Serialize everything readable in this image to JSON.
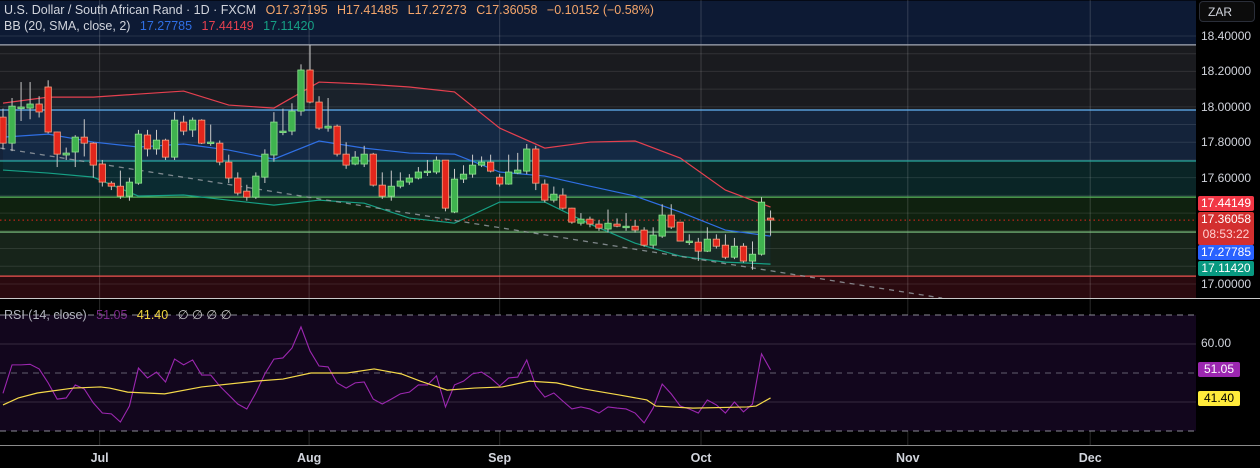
{
  "header": {
    "symbol_title": "U.S. Dollar / South African Rand · 1D · FXCM",
    "open": "O17.37195",
    "high": "H17.41485",
    "low": "L17.27273",
    "close": "C17.36058",
    "change": "−0.10152 (−0.58%)"
  },
  "bb_legend": {
    "label": "BB (20, SMA, close, 2)",
    "basis": "17.27785",
    "upper": "17.44149",
    "lower": "17.11420"
  },
  "rsi_legend": {
    "label": "RSI (14, close)",
    "rsi": "51.05",
    "ma": "41.40",
    "extras": "∅ ∅ ∅ ∅"
  },
  "price_axis": {
    "currency_button": "ZAR",
    "ticks": [
      "18.40000",
      "18.20000",
      "18.00000",
      "17.80000",
      "17.60000",
      "17.00000"
    ],
    "tick_values": [
      18.4,
      18.2,
      18.0,
      17.8,
      17.6,
      17.0
    ],
    "tags": {
      "upper": "17.44149",
      "last": "17.36058",
      "countdown": "08:53:22",
      "basis": "17.27785",
      "lower": "17.11420"
    }
  },
  "rsi_axis": {
    "tick": "60.00",
    "rsi_tag": "51.05",
    "ma_tag": "41.40"
  },
  "time_axis": [
    {
      "label": "Jul",
      "index": 10.7
    },
    {
      "label": "Aug",
      "index": 33.9
    },
    {
      "label": "Sep",
      "index": 55.0
    },
    {
      "label": "Oct",
      "index": 77.3
    },
    {
      "label": "Nov",
      "index": 100.2
    },
    {
      "label": "Dec",
      "index": 120.4
    }
  ],
  "colors": {
    "up": "#3fb34f",
    "down": "#e3261c",
    "bb_basis": "#2f6fe4",
    "bb_upper": "#e5404f",
    "bb_lower": "#16a085",
    "rsi": "#9c27b0",
    "rsi_ma": "#f5d94a",
    "ohlc_text": "#f5a66b"
  },
  "chart_data": {
    "type": "candlestick",
    "price_range": [
      16.9,
      18.45
    ],
    "candles": [
      [
        17.942,
        17.99,
        17.76,
        17.795
      ],
      [
        17.795,
        18.05,
        17.75,
        18.004
      ],
      [
        17.999,
        18.14,
        17.92,
        17.999
      ],
      [
        17.993,
        18.14,
        17.93,
        18.016
      ],
      [
        18.016,
        18.06,
        17.94,
        17.971
      ],
      [
        18.112,
        18.15,
        17.85,
        17.858
      ],
      [
        17.858,
        17.86,
        17.66,
        17.733
      ],
      [
        17.728,
        17.77,
        17.7,
        17.739
      ],
      [
        17.745,
        17.84,
        17.66,
        17.829
      ],
      [
        17.829,
        17.93,
        17.72,
        17.795
      ],
      [
        17.795,
        17.8,
        17.6,
        17.671
      ],
      [
        17.677,
        17.7,
        17.55,
        17.575
      ],
      [
        17.569,
        17.58,
        17.53,
        17.552
      ],
      [
        17.552,
        17.64,
        17.48,
        17.496
      ],
      [
        17.496,
        17.6,
        17.47,
        17.575
      ],
      [
        17.569,
        17.87,
        17.56,
        17.846
      ],
      [
        17.841,
        17.87,
        17.72,
        17.762
      ],
      [
        17.762,
        17.87,
        17.73,
        17.812
      ],
      [
        17.812,
        17.82,
        17.7,
        17.716
      ],
      [
        17.716,
        17.97,
        17.7,
        17.925
      ],
      [
        17.914,
        17.95,
        17.84,
        17.863
      ],
      [
        17.869,
        17.94,
        17.83,
        17.925
      ],
      [
        17.925,
        17.93,
        17.79,
        17.795
      ],
      [
        17.801,
        17.9,
        17.78,
        17.801
      ],
      [
        17.795,
        17.81,
        17.67,
        17.688
      ],
      [
        17.688,
        17.73,
        17.57,
        17.598
      ],
      [
        17.598,
        17.63,
        17.5,
        17.513
      ],
      [
        17.524,
        17.56,
        17.47,
        17.49
      ],
      [
        17.49,
        17.63,
        17.48,
        17.609
      ],
      [
        17.603,
        17.76,
        17.57,
        17.733
      ],
      [
        17.728,
        17.97,
        17.69,
        17.914
      ],
      [
        17.858,
        17.99,
        17.84,
        17.863
      ],
      [
        17.863,
        18.02,
        17.84,
        17.976
      ],
      [
        17.976,
        18.24,
        17.95,
        18.208
      ],
      [
        18.208,
        18.35,
        18.02,
        18.027
      ],
      [
        18.027,
        18.06,
        17.87,
        17.88
      ],
      [
        17.88,
        18.05,
        17.86,
        17.891
      ],
      [
        17.891,
        17.9,
        17.72,
        17.733
      ],
      [
        17.733,
        17.8,
        17.65,
        17.671
      ],
      [
        17.677,
        17.75,
        17.67,
        17.716
      ],
      [
        17.677,
        17.78,
        17.66,
        17.733
      ],
      [
        17.733,
        17.74,
        17.55,
        17.558
      ],
      [
        17.558,
        17.63,
        17.48,
        17.496
      ],
      [
        17.496,
        17.64,
        17.47,
        17.552
      ],
      [
        17.552,
        17.63,
        17.54,
        17.581
      ],
      [
        17.575,
        17.62,
        17.56,
        17.598
      ],
      [
        17.598,
        17.66,
        17.59,
        17.632
      ],
      [
        17.632,
        17.7,
        17.61,
        17.637
      ],
      [
        17.632,
        17.72,
        17.62,
        17.699
      ],
      [
        17.699,
        17.7,
        17.41,
        17.428
      ],
      [
        17.406,
        17.65,
        17.4,
        17.592
      ],
      [
        17.592,
        17.67,
        17.57,
        17.62
      ],
      [
        17.62,
        17.73,
        17.6,
        17.671
      ],
      [
        17.671,
        17.72,
        17.66,
        17.688
      ],
      [
        17.688,
        17.73,
        17.63,
        17.637
      ],
      [
        17.603,
        17.62,
        17.55,
        17.564
      ],
      [
        17.564,
        17.73,
        17.56,
        17.632
      ],
      [
        17.626,
        17.74,
        17.62,
        17.643
      ],
      [
        17.637,
        17.79,
        17.62,
        17.762
      ],
      [
        17.762,
        17.78,
        17.53,
        17.569
      ],
      [
        17.564,
        17.59,
        17.46,
        17.473
      ],
      [
        17.473,
        17.55,
        17.46,
        17.507
      ],
      [
        17.502,
        17.54,
        17.42,
        17.428
      ],
      [
        17.428,
        17.43,
        17.34,
        17.349
      ],
      [
        17.343,
        17.4,
        17.33,
        17.366
      ],
      [
        17.366,
        17.38,
        17.32,
        17.338
      ],
      [
        17.338,
        17.36,
        17.3,
        17.315
      ],
      [
        17.31,
        17.42,
        17.29,
        17.343
      ],
      [
        17.338,
        17.37,
        17.32,
        17.326
      ],
      [
        17.326,
        17.4,
        17.3,
        17.326
      ],
      [
        17.326,
        17.36,
        17.29,
        17.304
      ],
      [
        17.304,
        17.32,
        17.21,
        17.219
      ],
      [
        17.219,
        17.32,
        17.2,
        17.276
      ],
      [
        17.27,
        17.45,
        17.26,
        17.389
      ],
      [
        17.389,
        17.45,
        17.31,
        17.321
      ],
      [
        17.349,
        17.35,
        17.24,
        17.242
      ],
      [
        17.242,
        17.28,
        17.22,
        17.242
      ],
      [
        17.236,
        17.26,
        17.13,
        17.185
      ],
      [
        17.185,
        17.32,
        17.18,
        17.253
      ],
      [
        17.253,
        17.28,
        17.2,
        17.213
      ],
      [
        17.219,
        17.28,
        17.14,
        17.151
      ],
      [
        17.151,
        17.26,
        17.14,
        17.213
      ],
      [
        17.213,
        17.23,
        17.12,
        17.129
      ],
      [
        17.129,
        17.24,
        17.08,
        17.168
      ],
      [
        17.168,
        17.49,
        17.16,
        17.462
      ],
      [
        17.37195,
        17.41485,
        17.27273,
        17.36058
      ]
    ],
    "bb_sample_step": 5,
    "bb_upper": [
      18.021,
      18.055,
      18.055,
      18.072,
      18.089,
      18.01,
      17.993,
      18.14,
      18.129,
      18.112,
      18.084,
      17.88,
      17.767,
      17.801,
      17.807,
      17.711,
      17.53,
      17.434
    ],
    "bb_basis": [
      17.829,
      17.846,
      17.801,
      17.773,
      17.79,
      17.756,
      17.705,
      17.807,
      17.767,
      17.739,
      17.733,
      17.632,
      17.609,
      17.552,
      17.496,
      17.406,
      17.304,
      17.27
    ],
    "bb_lower": [
      17.643,
      17.626,
      17.603,
      17.496,
      17.502,
      17.473,
      17.445,
      17.473,
      17.456,
      17.372,
      17.343,
      17.462,
      17.462,
      17.338,
      17.23,
      17.157,
      17.123,
      17.112
    ],
    "trendline": [
      [
        -0.3,
        17.767
      ],
      [
        104,
        16.92
      ]
    ],
    "zones": [
      {
        "from": 18.6,
        "to": 18.35,
        "fill": "#0d1a34"
      },
      {
        "from": 18.35,
        "to": 17.982,
        "fill": "#1a1b1f"
      },
      {
        "from": 17.982,
        "to": 17.694,
        "fill": "#14233a"
      },
      {
        "from": 17.694,
        "to": 17.49,
        "fill": "#0a2526"
      },
      {
        "from": 17.49,
        "to": 17.293,
        "fill": "#0f210f"
      },
      {
        "from": 17.293,
        "to": 17.044,
        "fill": "#17241a"
      },
      {
        "from": 17.044,
        "to": 16.8,
        "fill": "#2a0a0f"
      }
    ],
    "levels": [
      {
        "price": 18.35,
        "color": "#a5a9b4"
      },
      {
        "price": 17.982,
        "color": "#64b5f6"
      },
      {
        "price": 17.694,
        "color": "#26a69a"
      },
      {
        "price": 17.49,
        "color": "#5cb85c"
      },
      {
        "price": 17.293,
        "color": "#81c784"
      },
      {
        "price": 17.044,
        "color": "#ef5350"
      }
    ],
    "last_price": 17.36058,
    "rsi": {
      "range": [
        0,
        100
      ],
      "bands": [
        70,
        50,
        30
      ],
      "grid": [
        60,
        40
      ],
      "values": [
        43,
        52.8,
        52.8,
        53,
        51.4,
        46.6,
        41,
        41.4,
        45.9,
        44.5,
        39.7,
        36.2,
        35.9,
        33.1,
        38.6,
        51.7,
        48.3,
        50.3,
        46.9,
        54.8,
        52.8,
        54.5,
        49.3,
        49.3,
        45.5,
        42.4,
        39.3,
        37.6,
        43.1,
        49.7,
        54.8,
        55.2,
        58.6,
        65.9,
        57.6,
        52.4,
        52.1,
        46.6,
        44.8,
        46.6,
        46.9,
        41,
        39.3,
        41,
        42.8,
        43.4,
        45.9,
        45.9,
        49,
        38.3,
        45.9,
        47.2,
        49.7,
        50.3,
        48.3,
        45.5,
        48.3,
        48.6,
        54.5,
        45.5,
        41.7,
        43.1,
        40.3,
        37.6,
        38.3,
        37.6,
        36.2,
        38.3,
        37.9,
        37.6,
        36.2,
        32.8,
        37.9,
        46.2,
        42.8,
        38.6,
        37.6,
        36.2,
        40.7,
        39,
        36.2,
        40,
        36.6,
        39.3,
        56.6,
        51.05
      ],
      "ma_points": [
        [
          0,
          39
        ],
        [
          1.7,
          41.4
        ],
        [
          3.8,
          43.1
        ],
        [
          7.8,
          44.8
        ],
        [
          10.8,
          45.2
        ],
        [
          11.8,
          44.8
        ],
        [
          13.8,
          43.4
        ],
        [
          17.9,
          42.8
        ],
        [
          22,
          45.2
        ],
        [
          28,
          47.2
        ],
        [
          31,
          47.9
        ],
        [
          34.1,
          50
        ],
        [
          38.1,
          50
        ],
        [
          41.1,
          51.4
        ],
        [
          44.1,
          49.7
        ],
        [
          46.2,
          47.2
        ],
        [
          49.2,
          44.1
        ],
        [
          52.2,
          44.8
        ],
        [
          55.3,
          45.2
        ],
        [
          58.3,
          47.2
        ],
        [
          61.3,
          46.6
        ],
        [
          64.3,
          44.5
        ],
        [
          68.3,
          42.4
        ],
        [
          71.3,
          40.7
        ],
        [
          72.3,
          38.6
        ],
        [
          76.4,
          37.9
        ],
        [
          82.4,
          38.3
        ],
        [
          83.4,
          38.6
        ],
        [
          85,
          41.4
        ]
      ]
    }
  }
}
